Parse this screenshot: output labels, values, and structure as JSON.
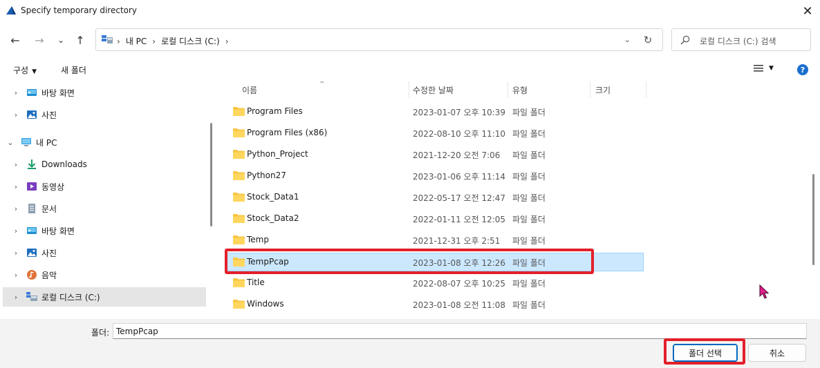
{
  "window": {
    "title": "Specify temporary directory",
    "close": "✕"
  },
  "nav": {
    "back": "←",
    "forward": "→",
    "history": "⌄",
    "up": "↑",
    "dropdown": "⌄",
    "refresh": "↻"
  },
  "address": {
    "crumbs": [
      "내 PC",
      "로컬 디스크 (C:)"
    ]
  },
  "search": {
    "placeholder": "로컬 디스크 (C:) 검색"
  },
  "toolbar": {
    "organize": "구성",
    "new_folder": "새 폴더",
    "help": "?"
  },
  "tree": [
    {
      "label": "바탕 화면",
      "icon": "desktop-icon",
      "expand": "›"
    },
    {
      "label": "사진",
      "icon": "pictures-icon",
      "expand": "›"
    },
    {
      "label": "내 PC",
      "icon": "pc-icon",
      "expand": "⌄"
    },
    {
      "label": "Downloads",
      "icon": "download-icon",
      "expand": "›"
    },
    {
      "label": "동영상",
      "icon": "video-icon",
      "expand": "›"
    },
    {
      "label": "문서",
      "icon": "document-icon",
      "expand": "›"
    },
    {
      "label": "바탕 화면",
      "icon": "desktop-icon",
      "expand": "›"
    },
    {
      "label": "사진",
      "icon": "pictures-icon",
      "expand": "›"
    },
    {
      "label": "음악",
      "icon": "music-icon",
      "expand": "›"
    },
    {
      "label": "로컬 디스크 (C:)",
      "icon": "drive-icon",
      "expand": "›",
      "selected": true
    }
  ],
  "columns": {
    "name": "이름",
    "modified": "수정한 날짜",
    "type": "유형",
    "size": "크기"
  },
  "files": [
    {
      "name": "Program Files",
      "date": "2023-01-07 오후 10:39",
      "type": "파일 폴더"
    },
    {
      "name": "Program Files (x86)",
      "date": "2022-08-10 오후 11:10",
      "type": "파일 폴더"
    },
    {
      "name": "Python_Project",
      "date": "2021-12-20 오전 7:06",
      "type": "파일 폴더"
    },
    {
      "name": "Python27",
      "date": "2023-01-06 오후 11:14",
      "type": "파일 폴더"
    },
    {
      "name": "Stock_Data1",
      "date": "2022-05-17 오전 12:47",
      "type": "파일 폴더"
    },
    {
      "name": "Stock_Data2",
      "date": "2022-01-11 오전 12:05",
      "type": "파일 폴더"
    },
    {
      "name": "Temp",
      "date": "2021-12-31 오후 2:51",
      "type": "파일 폴더"
    },
    {
      "name": "TempPcap",
      "date": "2023-01-08 오후 12:26",
      "type": "파일 폴더",
      "selected": true
    },
    {
      "name": "Title",
      "date": "2022-08-07 오후 10:25",
      "type": "파일 폴더"
    },
    {
      "name": "Windows",
      "date": "2023-01-08 오전 11:08",
      "type": "파일 폴더"
    }
  ],
  "footer": {
    "folder_label": "폴더:",
    "folder_value": "TempPcap",
    "select_button": "폴더 선택",
    "cancel_button": "취소"
  },
  "colors": {
    "highlight": "#e3202a",
    "selection": "#cce8ff",
    "folder": "#f8c542"
  }
}
